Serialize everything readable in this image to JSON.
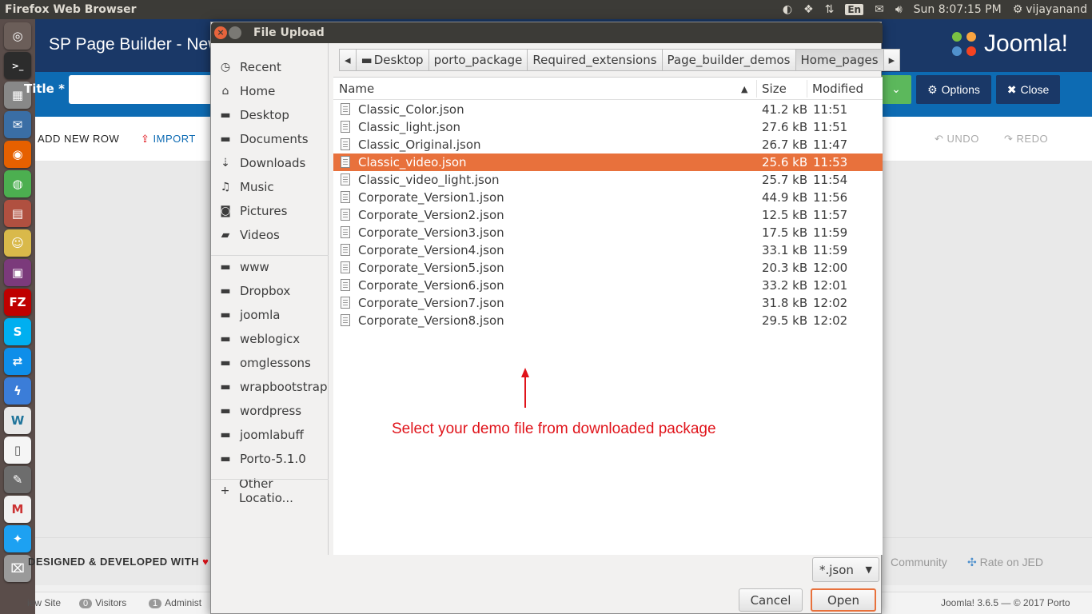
{
  "top_panel": {
    "app_title": "Firefox Web Browser",
    "keyboard_layout": "En",
    "clock": "Sun  8:07:15 PM",
    "user": "vijayanand"
  },
  "launcher": {
    "icons": [
      "ubuntu-dash-icon",
      "terminal-icon",
      "calculator-icon",
      "thunderbird-icon",
      "firefox-icon",
      "chrome-icon",
      "files-icon",
      "pidgin-icon",
      "media-icon",
      "filezilla-icon",
      "skype-icon",
      "teamviewer-icon",
      "thunder-icon",
      "wordpress-icon",
      "document-icon",
      "gimp-icon",
      "gmail-icon",
      "settings-icon",
      "twitter-icon",
      "trash-icon"
    ],
    "labels": {
      "filezilla": "FZ",
      "skype": "S",
      "wordpress": "W"
    }
  },
  "joomla": {
    "page_title": "SP Page Builder - New",
    "logo_text": "Joomla!",
    "title_label": "Title *",
    "options_label": "Options",
    "close_label": "Close",
    "add_new_row": "ADD NEW ROW",
    "import": "IMPORT",
    "undo": "UNDO",
    "redo": "REDO",
    "designed_by": "DESIGNED & DEVELOPED WITH",
    "community": "Community",
    "rate_on_jed": "Rate on JED",
    "status": {
      "view_site": "iew Site",
      "visitors_count": "0",
      "visitors_label": "Visitors",
      "admins_count": "1",
      "admins_label": "Administ",
      "version": "Joomla! 3.6.5  —  © 2017 Porto"
    },
    "colors": {
      "header": "#1a3867",
      "toolbar": "#0d6bb3",
      "save_green": "#5cb85c"
    }
  },
  "dialog": {
    "title": "File Upload",
    "sidebar": [
      {
        "icon": "clock-icon",
        "glyph": "◷",
        "label": "Recent"
      },
      {
        "icon": "home-icon",
        "glyph": "⌂",
        "label": "Home"
      },
      {
        "icon": "folder-icon",
        "glyph": "▬",
        "label": "Desktop"
      },
      {
        "icon": "folder-icon",
        "glyph": "▬",
        "label": "Documents"
      },
      {
        "icon": "download-icon",
        "glyph": "⇣",
        "label": "Downloads"
      },
      {
        "icon": "music-icon",
        "glyph": "♫",
        "label": "Music"
      },
      {
        "icon": "camera-icon",
        "glyph": "◙",
        "label": "Pictures"
      },
      {
        "icon": "video-icon",
        "glyph": "▰",
        "label": "Videos"
      },
      {
        "icon": "folder-icon",
        "glyph": "▬",
        "label": "www"
      },
      {
        "icon": "folder-icon",
        "glyph": "▬",
        "label": "Dropbox"
      },
      {
        "icon": "folder-icon",
        "glyph": "▬",
        "label": "joomla"
      },
      {
        "icon": "folder-icon",
        "glyph": "▬",
        "label": "weblogicx"
      },
      {
        "icon": "folder-icon",
        "glyph": "▬",
        "label": "omglessons"
      },
      {
        "icon": "folder-icon",
        "glyph": "▬",
        "label": "wrapbootstrap"
      },
      {
        "icon": "folder-icon",
        "glyph": "▬",
        "label": "wordpress"
      },
      {
        "icon": "folder-icon",
        "glyph": "▬",
        "label": "joomlabuff"
      },
      {
        "icon": "folder-icon",
        "glyph": "▬",
        "label": "Porto-5.1.0"
      },
      {
        "icon": "plus-icon",
        "glyph": "+",
        "label": "Other Locatio..."
      }
    ],
    "path": [
      "Desktop",
      "porto_package",
      "Required_extensions",
      "Page_builder_demos",
      "Home_pages"
    ],
    "columns": {
      "name": "Name",
      "size": "Size",
      "modified": "Modified"
    },
    "files": [
      {
        "name": "Classic_Color.json",
        "size": "41.2 kB",
        "modified": "11:51"
      },
      {
        "name": "Classic_light.json",
        "size": "27.6 kB",
        "modified": "11:51"
      },
      {
        "name": "Classic_Original.json",
        "size": "26.7 kB",
        "modified": "11:47"
      },
      {
        "name": "Classic_video.json",
        "size": "25.6 kB",
        "modified": "11:53",
        "selected": true
      },
      {
        "name": "Classic_video_light.json",
        "size": "25.7 kB",
        "modified": "11:54"
      },
      {
        "name": "Corporate_Version1.json",
        "size": "44.9 kB",
        "modified": "11:56"
      },
      {
        "name": "Corporate_Version2.json",
        "size": "12.5 kB",
        "modified": "11:57"
      },
      {
        "name": "Corporate_Version3.json",
        "size": "17.5 kB",
        "modified": "11:59"
      },
      {
        "name": "Corporate_Version4.json",
        "size": "33.1 kB",
        "modified": "11:59"
      },
      {
        "name": "Corporate_Version5.json",
        "size": "20.3 kB",
        "modified": "12:00"
      },
      {
        "name": "Corporate_Version6.json",
        "size": "33.2 kB",
        "modified": "12:01"
      },
      {
        "name": "Corporate_Version7.json",
        "size": "31.8 kB",
        "modified": "12:02"
      },
      {
        "name": "Corporate_Version8.json",
        "size": "29.5 kB",
        "modified": "12:02"
      }
    ],
    "annotation": "Select your demo file from downloaded package",
    "filter": "*.json",
    "cancel_label": "Cancel",
    "open_label": "Open",
    "colors": {
      "selection": "#e8713c",
      "annotation": "#e0131a"
    }
  }
}
